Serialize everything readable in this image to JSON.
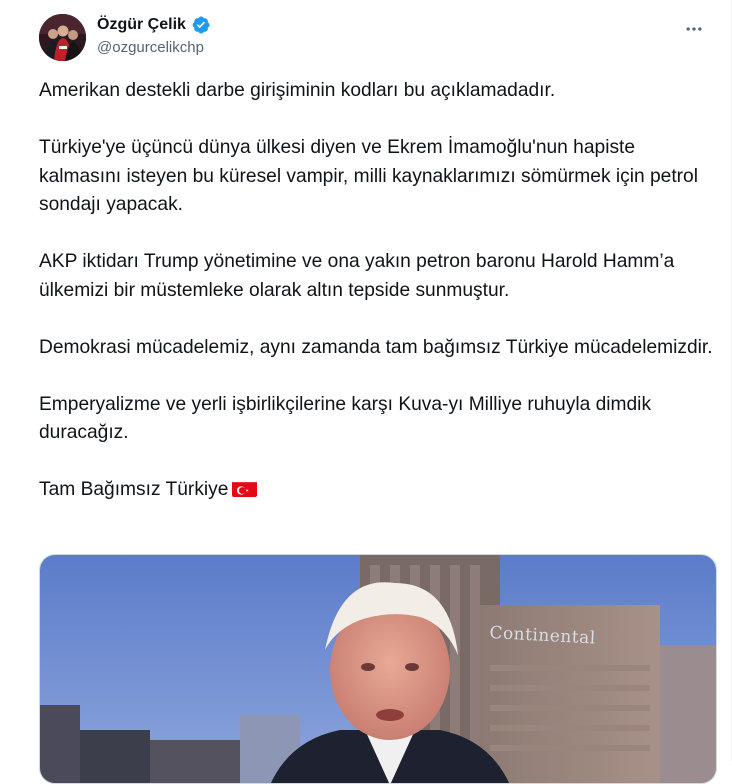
{
  "author": {
    "name": "Özgür Çelik",
    "handle": "@ozgurcelikchp",
    "verified": true,
    "verified_color": "#1d9bf0"
  },
  "menu": {
    "more_icon": "more-horizontal-icon"
  },
  "tweet": {
    "paragraphs": [
      "Amerikan destekli darbe girişiminin kodları bu açıklamadadır.",
      "Türkiye'ye üçüncü dünya ülkesi diyen ve Ekrem İmamoğlu'nun hapiste kalmasını isteyen bu küresel vampir, milli kaynaklarımızı sömürmek için petrol sondajı yapacak.",
      "AKP iktidarı Trump yönetimine ve ona yakın petron baronu Harold Hamm’a ülkemizi bir müstemleke olarak altın tepside sunmuştur.",
      "Demokrasi mücadelemiz, aynı zamanda tam bağımsız Türkiye mücadelemizdir.",
      "Emperyalizme ve yerli işbirlikçilerine karşı Kuva-yı Milliye ruhuyla dimdik duracağız.",
      "Tam Bağımsız Türkiye"
    ],
    "emoji": "turkey-flag-icon"
  },
  "media": {
    "type": "video-thumbnail",
    "building_sign": "Continental"
  },
  "colors": {
    "text_primary": "#0f1419",
    "text_secondary": "#536471",
    "border": "#cfd9de",
    "flag_red": "#e30a17"
  }
}
